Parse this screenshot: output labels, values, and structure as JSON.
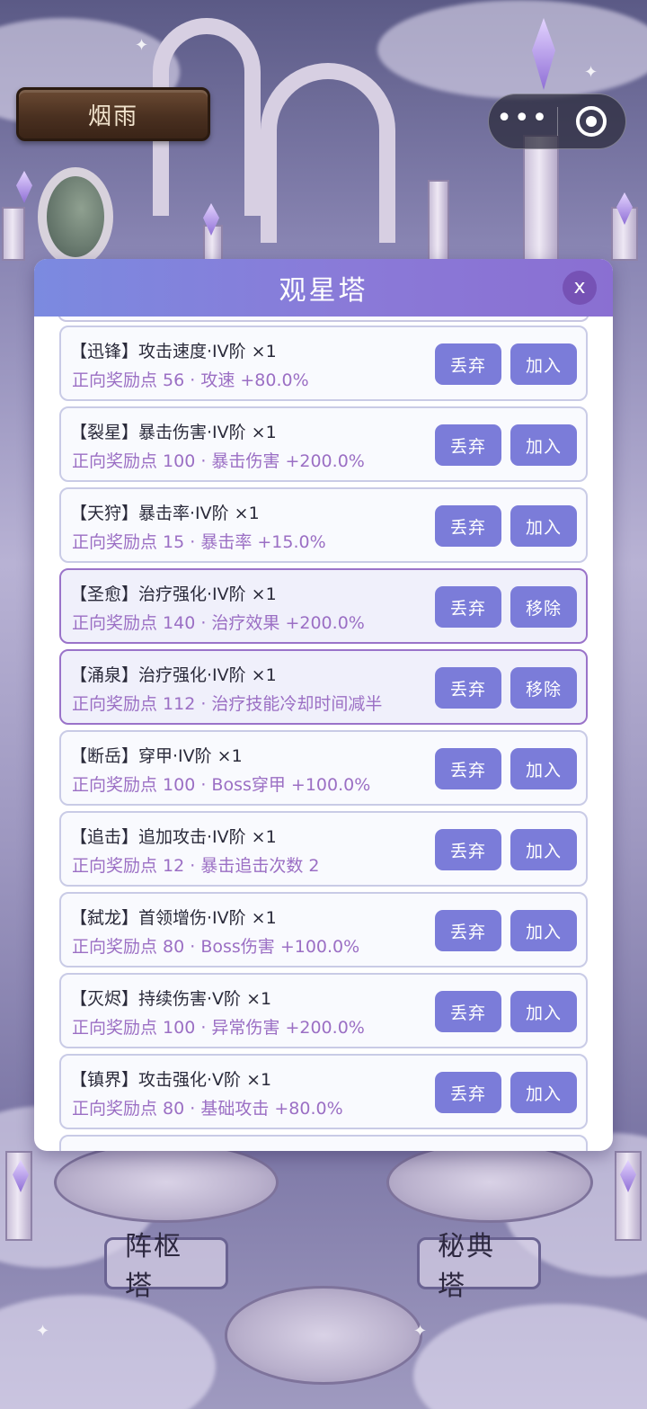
{
  "player": {
    "name": "烟雨"
  },
  "capsule": {
    "more_icon": "more-dots-icon",
    "target_icon": "target-icon"
  },
  "modal": {
    "title": "观星塔",
    "close_label": "x"
  },
  "cards": [
    {
      "title": "【迅锋】攻击速度·IV阶 ×1",
      "desc": "正向奖励点 56 · 攻速 +80.0%",
      "discard": "丢弃",
      "action": "加入",
      "selected": false
    },
    {
      "title": "【裂星】暴击伤害·IV阶 ×1",
      "desc": "正向奖励点 100 · 暴击伤害 +200.0%",
      "discard": "丢弃",
      "action": "加入",
      "selected": false
    },
    {
      "title": "【天狩】暴击率·IV阶 ×1",
      "desc": "正向奖励点 15 · 暴击率 +15.0%",
      "discard": "丢弃",
      "action": "加入",
      "selected": false
    },
    {
      "title": "【圣愈】治疗强化·IV阶 ×1",
      "desc": "正向奖励点 140 · 治疗效果 +200.0%",
      "discard": "丢弃",
      "action": "移除",
      "selected": true
    },
    {
      "title": "【涌泉】治疗强化·IV阶 ×1",
      "desc": "正向奖励点 112 · 治疗技能冷却时间减半",
      "discard": "丢弃",
      "action": "移除",
      "selected": true
    },
    {
      "title": "【断岳】穿甲·IV阶 ×1",
      "desc": "正向奖励点 100 · Boss穿甲 +100.0%",
      "discard": "丢弃",
      "action": "加入",
      "selected": false
    },
    {
      "title": "【追击】追加攻击·IV阶 ×1",
      "desc": "正向奖励点 12 · 暴击追击次数 2",
      "discard": "丢弃",
      "action": "加入",
      "selected": false
    },
    {
      "title": "【弑龙】首领增伤·IV阶 ×1",
      "desc": "正向奖励点 80 · Boss伤害 +100.0%",
      "discard": "丢弃",
      "action": "加入",
      "selected": false
    },
    {
      "title": "【灭烬】持续伤害·V阶 ×1",
      "desc": "正向奖励点 100 · 异常伤害 +200.0%",
      "discard": "丢弃",
      "action": "加入",
      "selected": false
    },
    {
      "title": "【镇界】攻击强化·V阶 ×1",
      "desc": "正向奖励点 80 · 基础攻击 +80.0%",
      "discard": "丢弃",
      "action": "加入",
      "selected": false
    }
  ],
  "towers": {
    "left": "阵枢塔",
    "right": "秘典塔"
  }
}
